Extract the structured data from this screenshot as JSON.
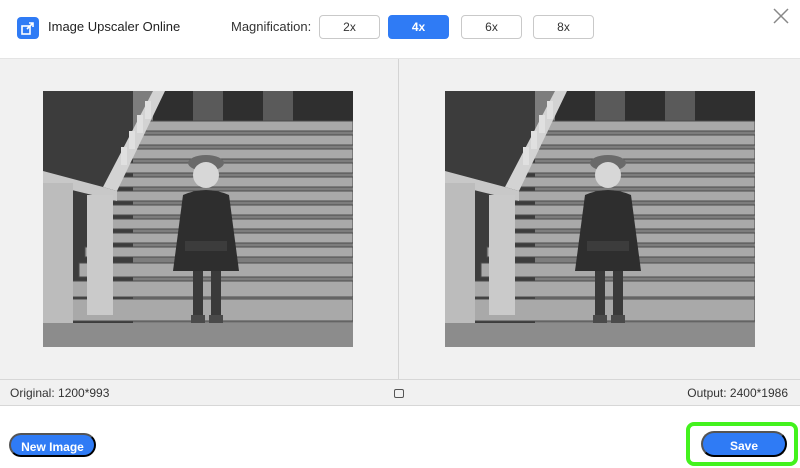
{
  "header": {
    "app_title": "Image Upscaler Online",
    "magnification_label": "Magnification:",
    "magnification_options": [
      "2x",
      "4x",
      "6x",
      "8x"
    ],
    "selected_magnification": "4x"
  },
  "preview": {
    "original_size_label": "Original: 1200*993",
    "output_size_label": "Output: 2400*1986"
  },
  "footer": {
    "new_image_label": "New Image",
    "save_label": "Save"
  },
  "colors": {
    "accent": "#2f7bf5",
    "highlight": "#43f21d",
    "panel_bg": "#f1f1f1"
  },
  "icons": [
    "image-upscale-logo-icon",
    "close-icon",
    "fit-toggle-icon"
  ]
}
